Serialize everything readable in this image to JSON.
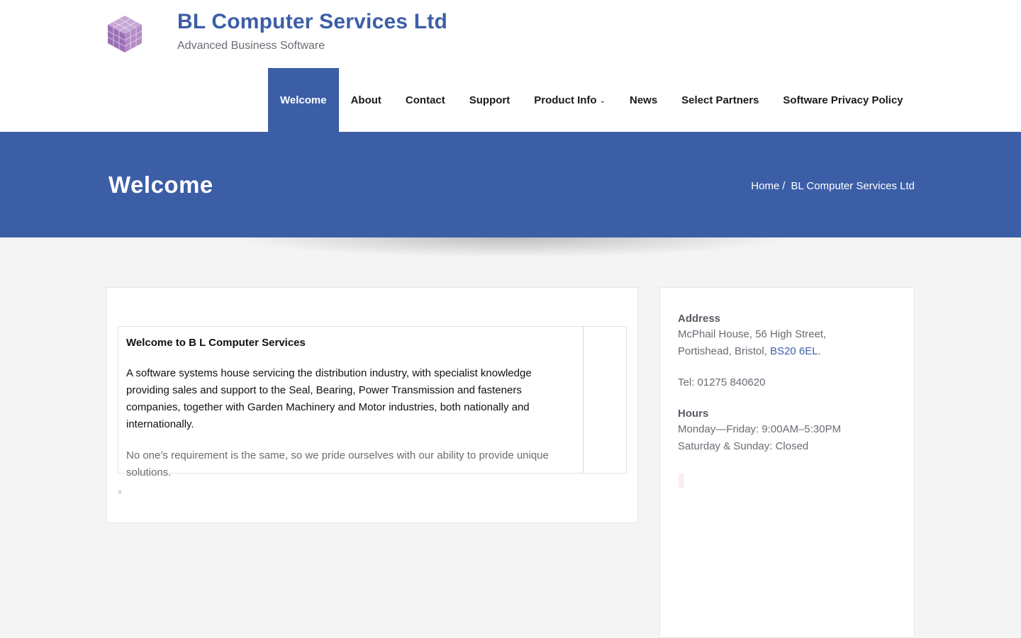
{
  "header": {
    "site_title": "BL Computer Services Ltd",
    "tagline": "Advanced Business Software"
  },
  "nav": {
    "items": [
      {
        "label": "Welcome",
        "active": true
      },
      {
        "label": "About"
      },
      {
        "label": "Contact"
      },
      {
        "label": "Support"
      },
      {
        "label": "Product Info",
        "has_dropdown": true
      },
      {
        "label": "News"
      },
      {
        "label": "Select Partners"
      },
      {
        "label": "Software Privacy Policy"
      }
    ]
  },
  "banner": {
    "title": "Welcome",
    "breadcrumb": {
      "home": "Home",
      "separator": "/",
      "current": "BL Computer Services Ltd"
    }
  },
  "content": {
    "heading": "Welcome to B L Computer Services",
    "paragraph_1": "A software systems house servicing the distribution industry, with specialist knowledge providing sales and support to the Seal, Bearing,  Power Transmission and fasteners companies, together with Garden Machinery and Motor industries, both nationally and internationally.",
    "paragraph_2": "No one’s requirement is the same, so we pride ourselves with our ability to provide unique solutions."
  },
  "sidebar": {
    "address_heading": "Address",
    "address_line_1": "McPhail House, 56 High Street,",
    "address_line_2_prefix": "Portishead, Bristol, ",
    "postcode": "BS20 6EL",
    "address_line_2_suffix": ".",
    "tel": "Tel: 01275 840620",
    "hours_heading": "Hours",
    "hours_weekday": "Monday—Friday: 9:00AM–5:30PM",
    "hours_weekend": "Saturday & Sunday: Closed"
  },
  "colors": {
    "brand_blue": "#3c5ea7",
    "page_bg": "#f4f4f4"
  }
}
